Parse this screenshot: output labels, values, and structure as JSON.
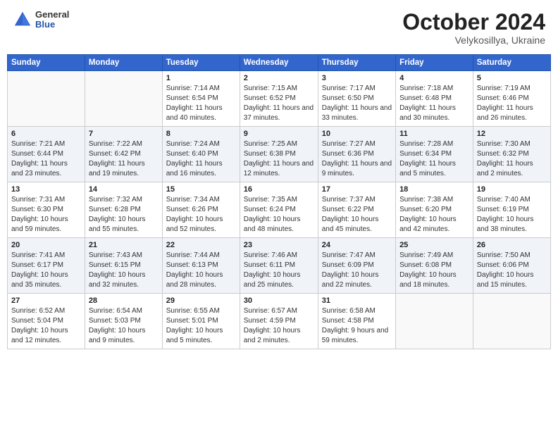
{
  "header": {
    "logo_general": "General",
    "logo_blue": "Blue",
    "month": "October 2024",
    "location": "Velykosillya, Ukraine"
  },
  "days_of_week": [
    "Sunday",
    "Monday",
    "Tuesday",
    "Wednesday",
    "Thursday",
    "Friday",
    "Saturday"
  ],
  "weeks": [
    [
      {
        "day": "",
        "info": ""
      },
      {
        "day": "",
        "info": ""
      },
      {
        "day": "1",
        "info": "Sunrise: 7:14 AM\nSunset: 6:54 PM\nDaylight: 11 hours and 40 minutes."
      },
      {
        "day": "2",
        "info": "Sunrise: 7:15 AM\nSunset: 6:52 PM\nDaylight: 11 hours and 37 minutes."
      },
      {
        "day": "3",
        "info": "Sunrise: 7:17 AM\nSunset: 6:50 PM\nDaylight: 11 hours and 33 minutes."
      },
      {
        "day": "4",
        "info": "Sunrise: 7:18 AM\nSunset: 6:48 PM\nDaylight: 11 hours and 30 minutes."
      },
      {
        "day": "5",
        "info": "Sunrise: 7:19 AM\nSunset: 6:46 PM\nDaylight: 11 hours and 26 minutes."
      }
    ],
    [
      {
        "day": "6",
        "info": "Sunrise: 7:21 AM\nSunset: 6:44 PM\nDaylight: 11 hours and 23 minutes."
      },
      {
        "day": "7",
        "info": "Sunrise: 7:22 AM\nSunset: 6:42 PM\nDaylight: 11 hours and 19 minutes."
      },
      {
        "day": "8",
        "info": "Sunrise: 7:24 AM\nSunset: 6:40 PM\nDaylight: 11 hours and 16 minutes."
      },
      {
        "day": "9",
        "info": "Sunrise: 7:25 AM\nSunset: 6:38 PM\nDaylight: 11 hours and 12 minutes."
      },
      {
        "day": "10",
        "info": "Sunrise: 7:27 AM\nSunset: 6:36 PM\nDaylight: 11 hours and 9 minutes."
      },
      {
        "day": "11",
        "info": "Sunrise: 7:28 AM\nSunset: 6:34 PM\nDaylight: 11 hours and 5 minutes."
      },
      {
        "day": "12",
        "info": "Sunrise: 7:30 AM\nSunset: 6:32 PM\nDaylight: 11 hours and 2 minutes."
      }
    ],
    [
      {
        "day": "13",
        "info": "Sunrise: 7:31 AM\nSunset: 6:30 PM\nDaylight: 10 hours and 59 minutes."
      },
      {
        "day": "14",
        "info": "Sunrise: 7:32 AM\nSunset: 6:28 PM\nDaylight: 10 hours and 55 minutes."
      },
      {
        "day": "15",
        "info": "Sunrise: 7:34 AM\nSunset: 6:26 PM\nDaylight: 10 hours and 52 minutes."
      },
      {
        "day": "16",
        "info": "Sunrise: 7:35 AM\nSunset: 6:24 PM\nDaylight: 10 hours and 48 minutes."
      },
      {
        "day": "17",
        "info": "Sunrise: 7:37 AM\nSunset: 6:22 PM\nDaylight: 10 hours and 45 minutes."
      },
      {
        "day": "18",
        "info": "Sunrise: 7:38 AM\nSunset: 6:20 PM\nDaylight: 10 hours and 42 minutes."
      },
      {
        "day": "19",
        "info": "Sunrise: 7:40 AM\nSunset: 6:19 PM\nDaylight: 10 hours and 38 minutes."
      }
    ],
    [
      {
        "day": "20",
        "info": "Sunrise: 7:41 AM\nSunset: 6:17 PM\nDaylight: 10 hours and 35 minutes."
      },
      {
        "day": "21",
        "info": "Sunrise: 7:43 AM\nSunset: 6:15 PM\nDaylight: 10 hours and 32 minutes."
      },
      {
        "day": "22",
        "info": "Sunrise: 7:44 AM\nSunset: 6:13 PM\nDaylight: 10 hours and 28 minutes."
      },
      {
        "day": "23",
        "info": "Sunrise: 7:46 AM\nSunset: 6:11 PM\nDaylight: 10 hours and 25 minutes."
      },
      {
        "day": "24",
        "info": "Sunrise: 7:47 AM\nSunset: 6:09 PM\nDaylight: 10 hours and 22 minutes."
      },
      {
        "day": "25",
        "info": "Sunrise: 7:49 AM\nSunset: 6:08 PM\nDaylight: 10 hours and 18 minutes."
      },
      {
        "day": "26",
        "info": "Sunrise: 7:50 AM\nSunset: 6:06 PM\nDaylight: 10 hours and 15 minutes."
      }
    ],
    [
      {
        "day": "27",
        "info": "Sunrise: 6:52 AM\nSunset: 5:04 PM\nDaylight: 10 hours and 12 minutes."
      },
      {
        "day": "28",
        "info": "Sunrise: 6:54 AM\nSunset: 5:03 PM\nDaylight: 10 hours and 9 minutes."
      },
      {
        "day": "29",
        "info": "Sunrise: 6:55 AM\nSunset: 5:01 PM\nDaylight: 10 hours and 5 minutes."
      },
      {
        "day": "30",
        "info": "Sunrise: 6:57 AM\nSunset: 4:59 PM\nDaylight: 10 hours and 2 minutes."
      },
      {
        "day": "31",
        "info": "Sunrise: 6:58 AM\nSunset: 4:58 PM\nDaylight: 9 hours and 59 minutes."
      },
      {
        "day": "",
        "info": ""
      },
      {
        "day": "",
        "info": ""
      }
    ]
  ]
}
